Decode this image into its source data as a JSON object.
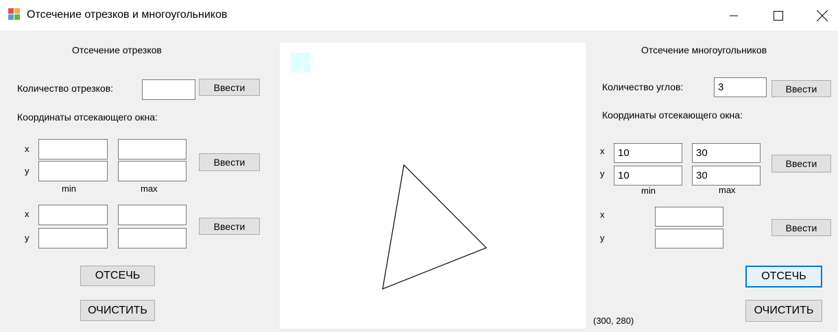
{
  "window": {
    "title": "Отсечение отрезков и многоугольников",
    "controls": [
      "minimize",
      "maximize",
      "close"
    ]
  },
  "left_panel": {
    "heading": "Отсечение отрезков",
    "count_label": "Количество отрезков:",
    "count_value": "",
    "count_submit": "Ввести",
    "window_coords_label": "Координаты отсекающего окна:",
    "window_block": {
      "x_label": "x",
      "y_label": "y",
      "x_min": "",
      "x_max": "",
      "y_min": "",
      "y_max": "",
      "min_label": "min",
      "max_label": "max",
      "submit": "Ввести"
    },
    "segment_block": {
      "x_label": "x",
      "y_label": "y",
      "x1": "",
      "x2": "",
      "y1": "",
      "y2": "",
      "submit": "Ввести"
    },
    "clip_button": "ОТСЕЧЬ",
    "clear_button": "ОЧИСТИТЬ"
  },
  "right_panel": {
    "heading": "Отсечение многоугольников",
    "count_label": "Количество углов:",
    "count_value": "3",
    "count_submit": "Ввести",
    "window_coords_label": "Координаты отсекающего окна:",
    "window_block": {
      "x_label": "x",
      "y_label": "y",
      "x_min": "10",
      "x_max": "30",
      "y_min": "10",
      "y_max": "30",
      "min_label": "min",
      "max_label": "max",
      "submit": "Ввести"
    },
    "vertex_block": {
      "x_label": "x",
      "y_label": "y",
      "x_value": "",
      "y_value": "",
      "submit": "Ввести"
    },
    "clip_button": "ОТСЕЧЬ",
    "clear_button": "ОЧИСТИТЬ",
    "cursor_coords": "(300, 280)"
  },
  "colors": {
    "clip_window_fill": "#e0ffff",
    "polygon_stroke": "#000000",
    "focus_border": "#0078d7"
  }
}
